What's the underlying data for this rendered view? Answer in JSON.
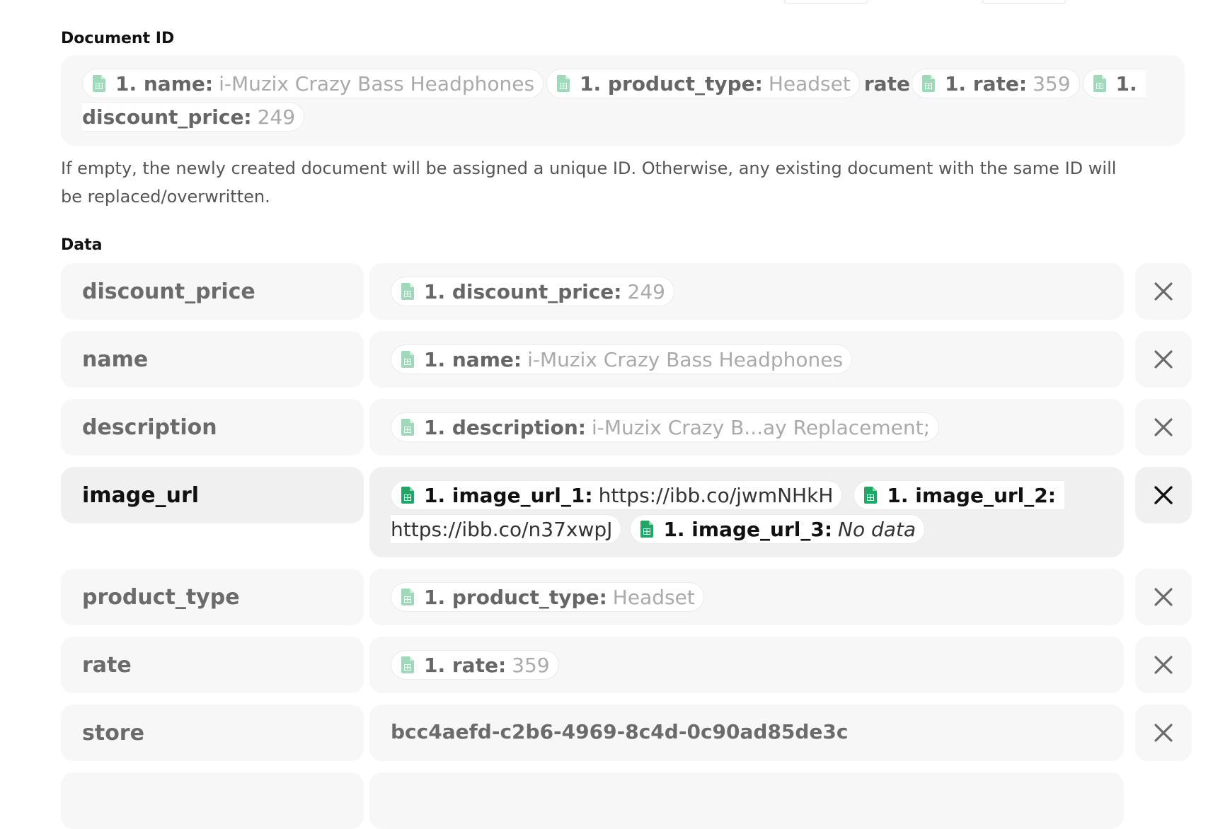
{
  "document_id": {
    "label": "Document ID",
    "tokens": [
      {
        "key": "1. name:",
        "value": "i-Muzix Crazy Bass Headphones"
      },
      {
        "key": "1. product_type:",
        "value": "Headset"
      },
      {
        "plain": "rate"
      },
      {
        "key": "1. rate:",
        "value": "359"
      },
      {
        "key": "1.",
        "key_cont": "discount_price:",
        "value": "249"
      }
    ],
    "help": "If empty, the newly created document will be assigned a unique ID. Otherwise, any existing document with the same ID will be replaced/overwritten."
  },
  "data": {
    "label": "Data",
    "rows": [
      {
        "key": "discount_price",
        "token_key": "1. discount_price:",
        "token_value": "249"
      },
      {
        "key": "name",
        "token_key": "1. name:",
        "token_value": "i-Muzix Crazy Bass Headphones"
      },
      {
        "key": "description",
        "token_key": "1. description:",
        "token_value": "i-Muzix Crazy B...ay Replacement;"
      },
      {
        "key": "image_url",
        "tokens": [
          {
            "key": "1. image_url_1:",
            "value": "https://ibb.co/jwmNHkH"
          },
          {
            "key": "1. image_url_2:",
            "value_cont": "https://ibb.co/n37xwpJ"
          },
          {
            "key": "1. image_url_3:",
            "value": "No data"
          }
        ]
      },
      {
        "key": "product_type",
        "token_key": "1. product_type:",
        "token_value": "Headset"
      },
      {
        "key": "rate",
        "token_key": "1. rate:",
        "token_value": "359"
      },
      {
        "key": "store",
        "plain_value": "bcc4aefd-c2b6-4969-8c4d-0c90ad85de3c"
      }
    ]
  },
  "icons": {
    "token_icon": "google-sheets-icon",
    "delete_icon": "close-icon"
  },
  "colors": {
    "sheets_green_active": "#23a566",
    "sheets_green_muted": "#9fd9b9",
    "field_bg": "#f7f7f7"
  }
}
